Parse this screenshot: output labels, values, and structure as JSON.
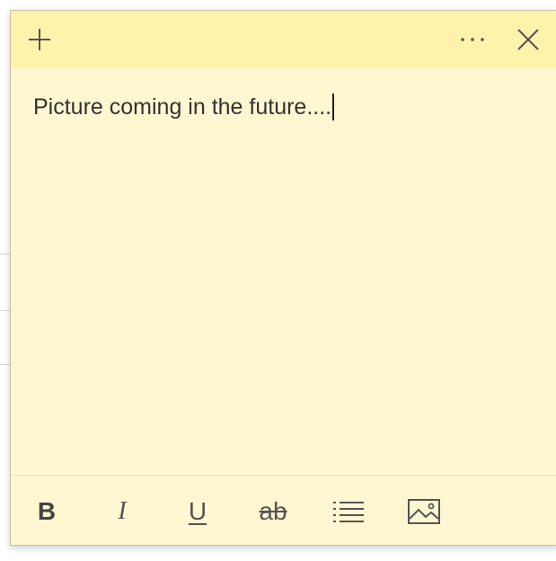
{
  "title_bar": {
    "add_icon": "plus-icon",
    "menu_icon": "more-horizontal-icon",
    "close_icon": "close-icon"
  },
  "note": {
    "text": "Picture coming in the future...."
  },
  "format_bar": {
    "bold_label": "B",
    "italic_label": "I",
    "underline_label": "U",
    "strikethrough_label": "ab",
    "list_icon": "bullet-list-icon",
    "image_icon": "image-icon"
  },
  "colors": {
    "title_bar": "#fff2ab",
    "note_body": "#fff7d1",
    "icon": "#555555",
    "text": "#333333"
  }
}
